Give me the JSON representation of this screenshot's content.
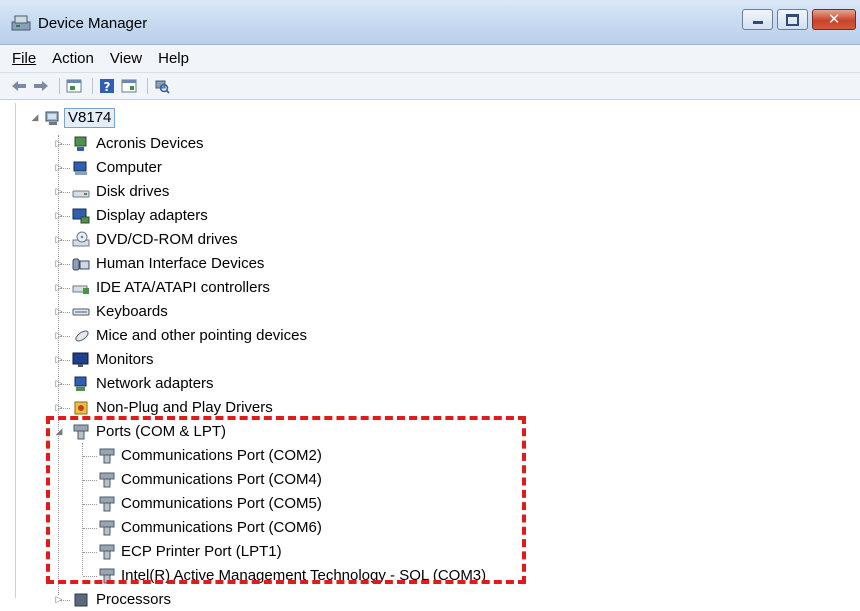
{
  "window": {
    "title": "Device Manager"
  },
  "menu": {
    "file": "File",
    "action": "Action",
    "view": "View",
    "help": "Help"
  },
  "toolbar": {
    "buttons": [
      "back-icon",
      "forward-icon",
      "properties-icon",
      "help-icon",
      "show-hide-icon",
      "scan-hardware-icon"
    ]
  },
  "tree": {
    "root": "V8174",
    "categories": [
      "Acronis Devices",
      "Computer",
      "Disk drives",
      "Display adapters",
      "DVD/CD-ROM drives",
      "Human Interface Devices",
      "IDE ATA/ATAPI controllers",
      "Keyboards",
      "Mice and other pointing devices",
      "Monitors",
      "Network adapters",
      "Non-Plug and Play Drivers",
      "Ports (COM & LPT)",
      "Processors"
    ],
    "ports_children": [
      "Communications Port (COM2)",
      "Communications Port (COM4)",
      "Communications Port (COM5)",
      "Communications Port (COM6)",
      "ECP Printer Port (LPT1)",
      "Intel(R) Active Management Technology - SOL (COM3)"
    ]
  },
  "colors": {
    "highlight": "#e01b1b",
    "selection": "#e4eefa"
  }
}
